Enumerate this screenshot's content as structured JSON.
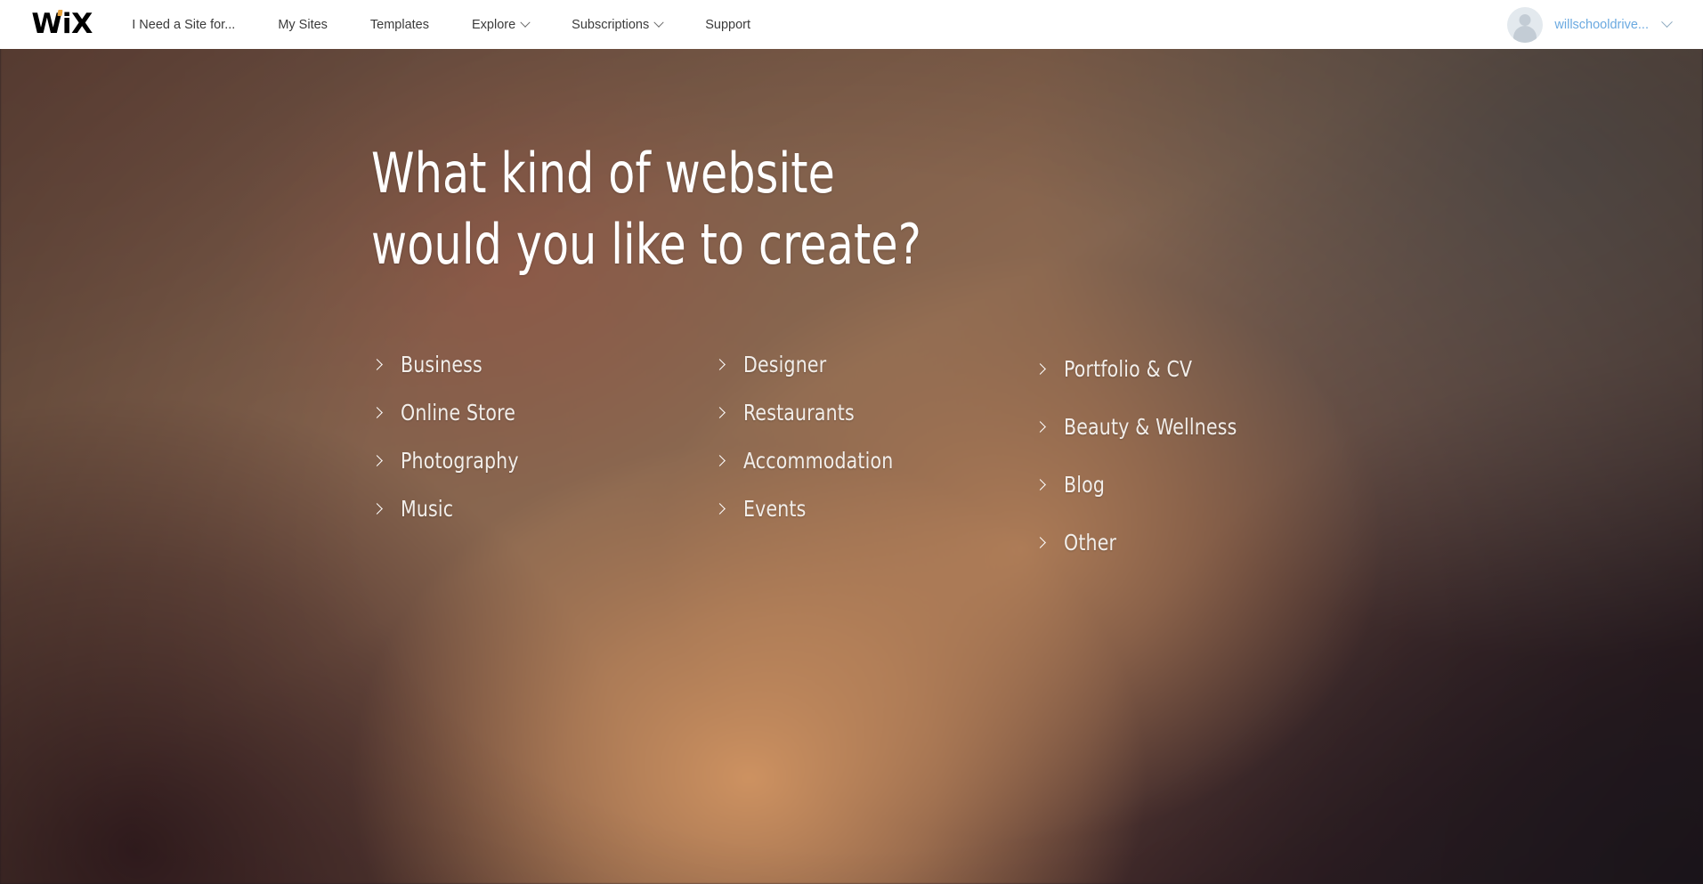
{
  "header": {
    "logo_text": "WiX",
    "logo_dot_color": "#e8a33d",
    "nav": [
      {
        "label": "I Need a Site for...",
        "has_dropdown": false
      },
      {
        "label": "My Sites",
        "has_dropdown": false
      },
      {
        "label": "Templates",
        "has_dropdown": false
      },
      {
        "label": "Explore",
        "has_dropdown": true
      },
      {
        "label": "Subscriptions",
        "has_dropdown": true
      },
      {
        "label": "Support",
        "has_dropdown": false
      }
    ],
    "account": {
      "name": "willschooldrive...",
      "name_color": "#6aa9e0",
      "avatar_icon": "user-avatar-icon",
      "dropdown_icon": "chevron-down-icon"
    }
  },
  "main": {
    "headline_line_1": "What kind of website",
    "headline_line_2": "would you like to create?",
    "columns": [
      {
        "items": [
          {
            "label": "Business",
            "icon": "chevron-right-icon"
          },
          {
            "label": "Online Store",
            "icon": "chevron-right-icon"
          },
          {
            "label": "Photography",
            "icon": "chevron-right-icon"
          },
          {
            "label": "Music",
            "icon": "chevron-right-icon"
          }
        ]
      },
      {
        "items": [
          {
            "label": "Designer",
            "icon": "chevron-right-icon"
          },
          {
            "label": "Restaurants",
            "icon": "chevron-right-icon"
          },
          {
            "label": "Accommodation",
            "icon": "chevron-right-icon"
          },
          {
            "label": "Events",
            "icon": "chevron-right-icon"
          }
        ]
      },
      {
        "items": [
          {
            "label": "Portfolio & CV",
            "icon": "chevron-right-icon"
          },
          {
            "label": "Beauty & Wellness",
            "icon": "chevron-right-icon"
          },
          {
            "label": "Blog",
            "icon": "chevron-right-icon"
          },
          {
            "label": "Other",
            "icon": "chevron-right-icon"
          }
        ]
      }
    ]
  },
  "theme": {
    "header_bg": "#ffffff",
    "nav_text": "#3b3b3b",
    "headline_color": "#ffffff",
    "category_color": "#f2eeea",
    "background_warm_brown": "#8b6850",
    "background_dark_maroon": "#3a2023",
    "background_gray_brown": "#514945",
    "background_dark_plum": "#2a2028"
  }
}
